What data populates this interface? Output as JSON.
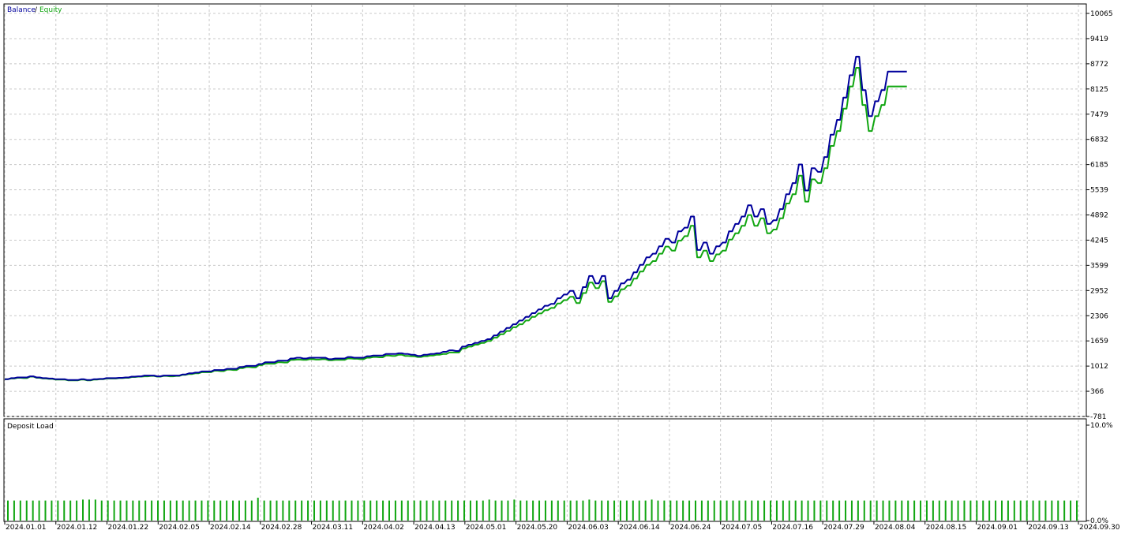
{
  "legend": {
    "balance": "Balance",
    "separator": "/",
    "equity": "Equity"
  },
  "colors": {
    "balance": "#00009c",
    "equity": "#11a611",
    "deposit_bar": "#11a611",
    "grid": "#c8c8c8",
    "frame": "#000000"
  },
  "chart_data": [
    {
      "type": "line",
      "title": "",
      "xlabel": "",
      "ylabel": "",
      "ylim": [
        -781,
        10065
      ],
      "y_ticks": [
        "10065",
        "9419",
        "8772",
        "8125",
        "7479",
        "6832",
        "6185",
        "5539",
        "4892",
        "4245",
        "3599",
        "2952",
        "2306",
        "1659",
        "1012",
        "366",
        "-781"
      ],
      "x_tick_labels": [
        "2024.01.01",
        "2024.01.12",
        "2024.01.22",
        "2024.02.05",
        "2024.02.14",
        "2024.02.28",
        "2024.03.11",
        "2024.04.02",
        "2024.04.13",
        "2024.05.01",
        "2024.05.20",
        "2024.06.03",
        "2024.06.14",
        "2024.06.24",
        "2024.07.05",
        "2024.07.16",
        "2024.07.29",
        "2024.08.04",
        "2024.08.15",
        "2024.09.01",
        "2024.09.13",
        "2024.09.30"
      ],
      "grid": true,
      "legend": "top-left",
      "x": [
        0,
        2,
        4,
        6,
        8,
        10,
        12,
        14,
        16,
        18,
        20,
        22,
        24,
        26,
        28,
        30,
        32,
        34,
        36,
        38,
        40,
        42,
        44,
        46,
        48,
        50,
        52,
        54,
        56,
        58,
        60,
        62,
        64,
        66,
        68,
        70,
        72,
        74,
        76,
        78,
        80,
        82,
        84,
        86,
        88,
        90,
        92,
        94,
        96,
        98,
        100,
        102,
        104,
        106,
        108,
        110,
        112,
        114,
        116,
        118,
        120,
        122,
        124,
        126,
        128,
        130,
        132,
        134,
        136,
        138,
        140,
        142,
        144,
        146,
        148,
        150,
        152,
        154,
        156,
        158,
        160,
        162,
        164,
        166,
        168,
        170,
        172,
        174,
        176,
        178,
        180,
        182,
        184,
        186,
        188,
        190,
        192,
        194,
        196,
        198,
        200,
        202,
        204,
        206,
        208,
        210,
        212,
        214,
        216,
        218,
        220,
        222,
        224,
        226,
        228,
        230,
        232,
        234,
        236,
        238,
        240,
        242,
        244,
        246,
        248,
        250,
        252,
        254,
        256,
        258,
        260,
        262,
        264,
        266,
        268,
        270,
        272,
        274,
        276,
        278,
        280,
        282,
        284,
        286,
        288,
        290,
        292,
        294,
        296,
        298,
        300,
        302,
        304,
        306,
        308,
        310,
        312,
        314,
        316,
        318,
        320,
        322,
        324,
        326,
        328,
        330,
        332,
        334,
        336,
        338,
        340,
        342,
        344,
        346,
        348,
        350,
        352,
        354,
        356,
        358,
        360,
        362,
        364,
        366,
        368,
        370,
        372,
        374,
        376,
        378,
        380,
        382,
        384,
        386,
        388,
        390,
        392,
        394,
        396,
        398,
        400,
        402,
        404,
        406,
        408,
        410,
        412,
        414,
        416,
        418,
        420,
        422,
        424,
        426,
        428,
        430,
        432,
        434,
        436,
        438,
        440,
        442,
        444,
        446,
        448,
        450,
        452,
        454,
        456,
        458,
        460,
        462,
        464,
        466,
        468,
        470,
        472,
        474,
        476,
        478,
        480,
        482,
        484,
        486,
        488,
        490,
        492,
        494,
        496,
        498,
        500,
        502,
        504,
        506,
        508,
        510,
        512,
        514,
        516,
        518,
        520,
        522,
        524,
        526,
        528,
        530,
        532,
        534,
        536,
        538,
        540,
        542,
        544,
        546,
        548,
        550,
        552,
        554,
        556,
        558,
        560,
        562,
        564,
        566,
        568,
        570,
        572,
        574,
        576,
        578,
        580,
        582,
        584,
        586,
        588,
        590,
        592,
        594,
        596,
        598,
        600,
        602,
        604,
        606,
        608,
        610,
        612,
        614,
        616,
        618,
        620,
        622,
        624,
        626,
        628,
        630,
        632,
        634,
        636,
        638,
        640,
        642,
        644,
        646,
        648,
        650,
        652,
        654,
        656,
        658,
        660,
        662,
        664,
        666,
        668,
        670,
        672,
        674,
        676,
        678
      ],
      "series": [
        {
          "name": "Balance",
          "values": [
            220,
            220,
            250,
            250,
            270,
            270,
            270,
            270,
            300,
            300,
            270,
            270,
            250,
            250,
            240,
            240,
            220,
            220,
            220,
            220,
            200,
            200,
            200,
            200,
            220,
            220,
            200,
            200,
            220,
            220,
            230,
            230,
            250,
            250,
            250,
            250,
            260,
            260,
            270,
            270,
            290,
            290,
            300,
            300,
            320,
            320,
            320,
            320,
            300,
            300,
            320,
            320,
            320,
            320,
            320,
            320,
            350,
            350,
            380,
            380,
            400,
            400,
            430,
            430,
            430,
            430,
            470,
            470,
            470,
            470,
            500,
            500,
            500,
            500,
            550,
            550,
            580,
            580,
            580,
            580,
            630,
            630,
            680,
            680,
            680,
            680,
            720,
            720,
            720,
            720,
            780,
            780,
            800,
            800,
            780,
            780,
            800,
            800,
            800,
            800,
            800,
            800,
            760,
            760,
            780,
            780,
            780,
            780,
            820,
            820,
            800,
            800,
            800,
            800,
            840,
            840,
            860,
            860,
            860,
            860,
            900,
            900,
            900,
            900,
            920,
            920,
            900,
            900,
            880,
            880,
            850,
            850,
            880,
            880,
            900,
            900,
            920,
            920,
            960,
            960,
            1000,
            1000,
            980,
            980,
            1100,
            1100,
            1150,
            1150,
            1200,
            1200,
            1250,
            1250,
            1300,
            1300,
            1400,
            1400,
            1500,
            1500,
            1600,
            1600,
            1700,
            1700,
            1800,
            1800,
            1900,
            1900,
            2000,
            2000,
            2100,
            2100,
            2200,
            2200,
            2250,
            2250,
            2400,
            2400,
            2500,
            2500,
            2600,
            2600,
            2400,
            2400,
            2700,
            2700,
            3000,
            3000,
            2800,
            2800,
            3000,
            3000,
            2400,
            2400,
            2600,
            2600,
            2800,
            2800,
            2900,
            2900,
            3100,
            3100,
            3300,
            3300,
            3500,
            3500,
            3600,
            3600,
            3800,
            3800,
            4000,
            4000,
            3900,
            3900,
            4200,
            4200,
            4300,
            4300,
            4600,
            4600,
            3700,
            3700,
            3900,
            3900,
            3600,
            3600,
            3800,
            3800,
            3900,
            3900,
            4200,
            4200,
            4400,
            4400,
            4600,
            4600,
            4900,
            4900,
            4600,
            4600,
            4800,
            4800,
            4400,
            4400,
            4500,
            4500,
            4800,
            4800,
            5200,
            5200,
            5500,
            5500,
            6000,
            6000,
            5300,
            5300,
            5900,
            5900,
            5800,
            5800,
            6200,
            6200,
            6800,
            6800,
            7200,
            7200,
            7800,
            7800,
            8400,
            8400,
            8900,
            8900,
            8000,
            8000,
            7300,
            7300,
            7700,
            7700,
            8000,
            8000,
            8500,
            8500,
            8500,
            8500,
            8500,
            8500,
            8500
          ]
        },
        {
          "name": "Equity",
          "values": [
            220,
            220,
            240,
            240,
            260,
            260,
            250,
            250,
            290,
            290,
            260,
            260,
            240,
            240,
            230,
            230,
            210,
            210,
            210,
            210,
            190,
            190,
            190,
            190,
            210,
            210,
            190,
            190,
            210,
            210,
            220,
            220,
            240,
            240,
            240,
            240,
            250,
            250,
            260,
            260,
            280,
            280,
            290,
            290,
            300,
            300,
            310,
            310,
            290,
            290,
            310,
            310,
            300,
            300,
            310,
            310,
            340,
            340,
            360,
            360,
            380,
            380,
            410,
            410,
            410,
            410,
            450,
            450,
            440,
            440,
            480,
            480,
            470,
            470,
            520,
            520,
            550,
            550,
            540,
            540,
            600,
            600,
            640,
            640,
            640,
            640,
            680,
            680,
            670,
            670,
            740,
            740,
            750,
            750,
            740,
            740,
            760,
            760,
            750,
            750,
            760,
            760,
            730,
            730,
            740,
            740,
            740,
            740,
            780,
            780,
            770,
            770,
            760,
            760,
            800,
            800,
            820,
            820,
            810,
            810,
            860,
            860,
            850,
            850,
            880,
            880,
            850,
            850,
            840,
            840,
            820,
            820,
            840,
            840,
            860,
            860,
            880,
            880,
            900,
            900,
            940,
            940,
            940,
            940,
            1050,
            1050,
            1100,
            1100,
            1150,
            1150,
            1200,
            1200,
            1250,
            1250,
            1340,
            1340,
            1430,
            1430,
            1520,
            1520,
            1620,
            1620,
            1700,
            1700,
            1800,
            1800,
            1900,
            1900,
            1990,
            1990,
            2080,
            2080,
            2140,
            2140,
            2260,
            2260,
            2350,
            2350,
            2440,
            2440,
            2270,
            2270,
            2540,
            2540,
            2820,
            2820,
            2670,
            2670,
            2860,
            2860,
            2300,
            2300,
            2450,
            2450,
            2640,
            2640,
            2740,
            2740,
            2930,
            2930,
            3120,
            3120,
            3300,
            3300,
            3400,
            3400,
            3600,
            3600,
            3790,
            3790,
            3680,
            3680,
            3950,
            3950,
            4070,
            4070,
            4350,
            4350,
            3500,
            3500,
            3680,
            3680,
            3400,
            3400,
            3580,
            3580,
            3680,
            3680,
            3980,
            3980,
            4150,
            4150,
            4350,
            4350,
            4640,
            4640,
            4350,
            4350,
            4550,
            4550,
            4150,
            4150,
            4250,
            4250,
            4550,
            4550,
            4950,
            4950,
            5200,
            5200,
            5700,
            5700,
            5000,
            5000,
            5600,
            5600,
            5500,
            5500,
            5900,
            5900,
            6500,
            6500,
            6900,
            6900,
            7500,
            7500,
            8100,
            8100,
            8600,
            8600,
            7600,
            7600,
            6900,
            6900,
            7300,
            7300,
            7600,
            7600,
            8100,
            8100,
            8100,
            8100,
            8100,
            8100,
            8100
          ]
        }
      ]
    },
    {
      "type": "bar",
      "title": "Deposit Load",
      "xlabel": "",
      "ylabel": "",
      "ylim": [
        0,
        10
      ],
      "y_tick_labels": [
        "10.0%",
        "0.0%"
      ],
      "bar_count": 172,
      "values_percent": [
        2.1,
        2.1,
        2.1,
        2.1,
        2.1,
        2.1,
        2.1,
        2.1,
        2.1,
        2.1,
        2.1,
        2.1,
        2.2,
        2.2,
        2.2,
        2.1,
        2.1,
        2.1,
        2.1,
        2.1,
        2.1,
        2.1,
        2.1,
        2.1,
        2.1,
        2.1,
        2.1,
        2.1,
        2.1,
        2.1,
        2.1,
        2.1,
        2.1,
        2.1,
        2.1,
        2.1,
        2.1,
        2.1,
        2.1,
        2.1,
        2.4,
        2.1,
        2.1,
        2.1,
        2.1,
        2.1,
        2.1,
        2.1,
        2.1,
        2.1,
        2.1,
        2.1,
        2.1,
        2.1,
        2.1,
        2.1,
        2.1,
        2.1,
        2.1,
        2.1,
        2.1,
        2.1,
        2.1,
        2.1,
        2.1,
        2.1,
        2.1,
        2.1,
        2.1,
        2.1,
        2.1,
        2.1,
        2.1,
        2.1,
        2.1,
        2.1,
        2.1,
        2.2,
        2.1,
        2.1,
        2.1,
        2.2,
        2.1,
        2.1,
        2.1,
        2.1,
        2.1,
        2.1,
        2.1,
        2.1,
        2.1,
        2.1,
        2.1,
        2.2,
        2.1,
        2.1,
        2.1,
        2.1,
        2.1,
        2.1,
        2.1,
        2.1,
        2.1,
        2.2,
        2.1,
        2.1,
        2.1,
        2.1,
        2.1,
        2.1,
        2.1,
        2.1,
        2.1,
        2.1,
        2.1,
        2.1,
        2.1,
        2.1,
        2.1,
        2.1,
        2.1,
        2.1,
        2.1,
        2.1,
        2.1,
        2.1,
        2.1,
        2.1,
        2.1,
        2.1,
        2.1,
        2.1,
        2.1,
        2.1,
        2.1,
        2.1,
        2.1,
        2.1,
        2.1,
        2.1,
        2.1,
        2.1,
        2.1,
        2.1,
        2.1,
        2.1,
        2.1,
        2.1,
        2.1,
        2.1,
        2.1,
        2.1,
        2.1,
        2.1,
        2.1,
        2.1,
        2.1,
        2.1,
        2.1,
        2.1,
        2.1,
        2.1,
        2.1,
        2.1,
        2.1,
        2.1,
        2.1,
        2.1,
        2.1,
        2.1,
        2.1,
        2.1
      ]
    }
  ]
}
